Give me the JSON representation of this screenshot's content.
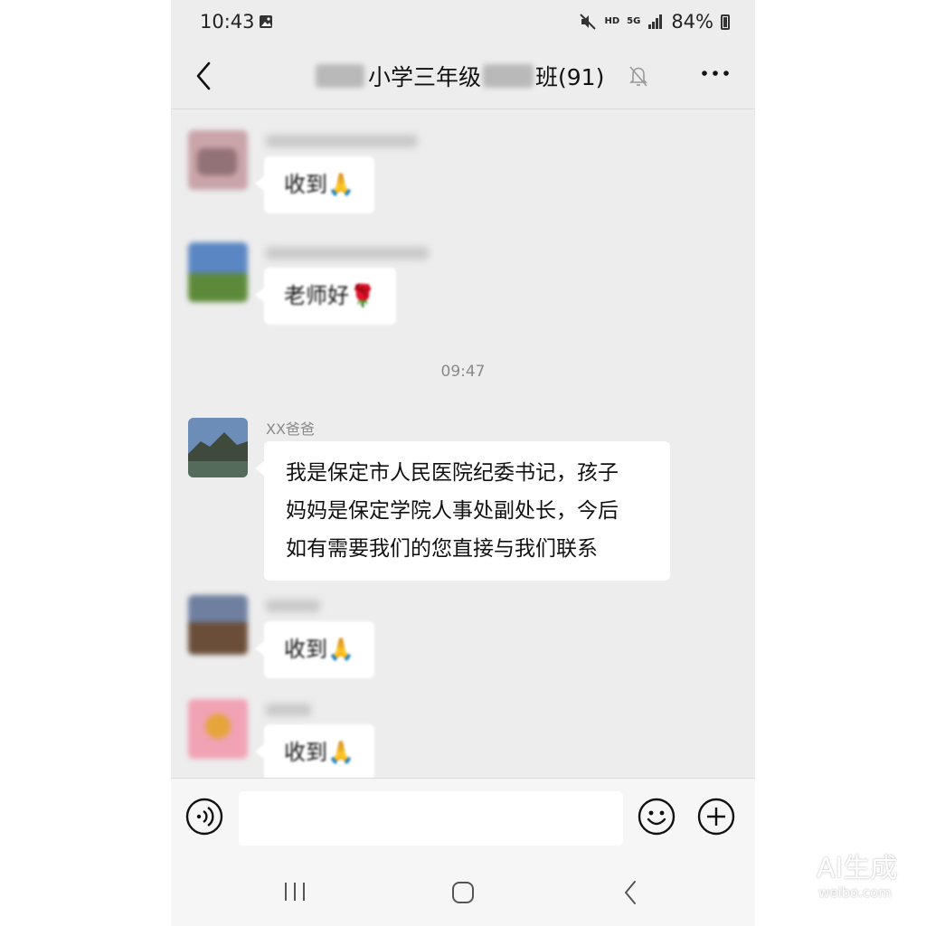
{
  "status_bar": {
    "time": "10:43",
    "hd": "HD",
    "network": "5G",
    "battery": "84%"
  },
  "header": {
    "title_part1": "小学三年级",
    "title_part2": "班(91)"
  },
  "messages": [
    {
      "text": "收到🙏",
      "avatar_colors": [
        "#c9a4a9",
        "#7b5c63"
      ]
    },
    {
      "text": "老师好🌹",
      "avatar_colors": [
        "#5a86c4",
        "#5d8a3a"
      ]
    },
    {
      "timestamp": "09:47"
    },
    {
      "sender": "XX爸爸",
      "lines": [
        "我是保定市人民医院纪委书记，孩子",
        "妈妈是保定学院人事处副处长，今后",
        "如有需要我们的您直接与我们联系"
      ],
      "avatar_colors": [
        "#6b8db8",
        "#3f4a3c"
      ]
    },
    {
      "text": "收到🙏",
      "avatar_colors": [
        "#6e7fa0",
        "#6b4e3a"
      ]
    },
    {
      "text": "收到🙏",
      "avatar_colors": [
        "#f1a2b4",
        "#e6a53b"
      ]
    }
  ],
  "watermark": {
    "line1": "AI生成",
    "line2": "weibo.com"
  }
}
